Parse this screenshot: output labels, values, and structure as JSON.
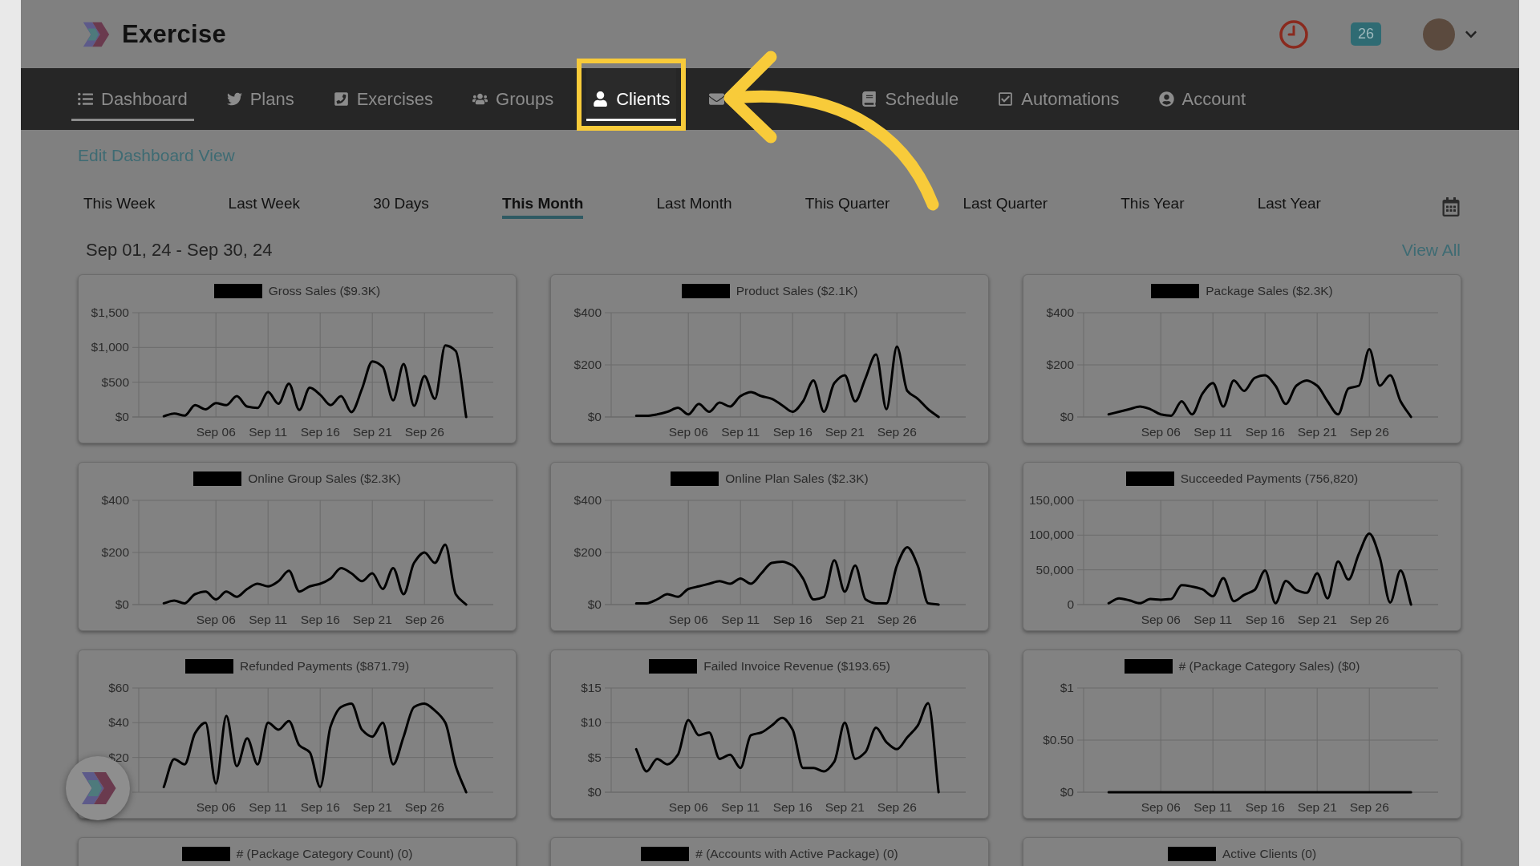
{
  "header": {
    "brand": "Exercise",
    "notification_count": "26"
  },
  "nav": {
    "items": [
      {
        "label": "Dashboard",
        "selected": true,
        "highlighted": false
      },
      {
        "label": "Plans",
        "selected": false,
        "highlighted": false
      },
      {
        "label": "Exercises",
        "selected": false,
        "highlighted": false
      },
      {
        "label": "Groups",
        "selected": false,
        "highlighted": false
      },
      {
        "label": "Clients",
        "selected": false,
        "highlighted": true
      },
      {
        "selected": false,
        "highlighted": false
      },
      {
        "label": "Schedule",
        "selected": false,
        "highlighted": false
      },
      {
        "label": "Automations",
        "selected": false,
        "highlighted": false
      },
      {
        "label": "Account",
        "selected": false,
        "highlighted": false
      }
    ]
  },
  "edit_link": "Edit Dashboard View",
  "ranges": [
    {
      "label": "This Week",
      "selected": false
    },
    {
      "label": "Last Week",
      "selected": false
    },
    {
      "label": "30 Days",
      "selected": false
    },
    {
      "label": "This Month",
      "selected": true
    },
    {
      "label": "Last Month",
      "selected": false
    },
    {
      "label": "This Quarter",
      "selected": false
    },
    {
      "label": "Last Quarter",
      "selected": false
    },
    {
      "label": "This Year",
      "selected": false
    },
    {
      "label": "Last Year",
      "selected": false
    }
  ],
  "date_range": "Sep 01, 24 - Sep 30, 24",
  "view_all": "View All",
  "cards": [
    {
      "chart_data": {
        "type": "line",
        "grid": true,
        "series": [
          {
            "name": "Gross Sales ($9.3K)",
            "color": "#000000",
            "values": [
              10,
              50,
              20,
              170,
              110,
              200,
              170,
              300,
              150,
              130,
              360,
              190,
              480,
              100,
              420,
              320,
              170,
              300,
              70,
              400,
              800,
              720,
              240,
              760,
              160,
              590,
              260,
              1030,
              950,
              0
            ]
          }
        ],
        "categories": [
          null,
          null,
          null,
          null,
          null,
          "Sep 06",
          null,
          null,
          null,
          null,
          "Sep 11",
          null,
          null,
          null,
          null,
          "Sep 16",
          null,
          null,
          null,
          null,
          "Sep 21",
          null,
          null,
          null,
          null,
          "Sep 26",
          null,
          null,
          null,
          null
        ],
        "ylim": [
          0,
          1500
        ],
        "yticks": [
          {
            "value": 0,
            "label": "$0"
          },
          {
            "value": 500,
            "label": "$500"
          },
          {
            "value": 1000,
            "label": "$1,000"
          },
          {
            "value": 1500,
            "label": "$1,500"
          }
        ]
      }
    },
    {
      "chart_data": {
        "type": "line",
        "grid": true,
        "series": [
          {
            "name": "Product Sales ($2.1K)",
            "color": "#000000",
            "values": [
              5,
              5,
              10,
              20,
              35,
              10,
              50,
              20,
              55,
              40,
              80,
              95,
              80,
              70,
              45,
              20,
              60,
              140,
              20,
              130,
              160,
              60,
              150,
              240,
              30,
              270,
              100,
              70,
              30,
              0
            ]
          }
        ],
        "categories": [
          null,
          null,
          null,
          null,
          null,
          "Sep 06",
          null,
          null,
          null,
          null,
          "Sep 11",
          null,
          null,
          null,
          null,
          "Sep 16",
          null,
          null,
          null,
          null,
          "Sep 21",
          null,
          null,
          null,
          null,
          "Sep 26",
          null,
          null,
          null,
          null
        ],
        "ylim": [
          0,
          400
        ],
        "yticks": [
          {
            "value": 0,
            "label": "$0"
          },
          {
            "value": 200,
            "label": "$200"
          },
          {
            "value": 400,
            "label": "$400"
          }
        ]
      }
    },
    {
      "chart_data": {
        "type": "line",
        "grid": true,
        "series": [
          {
            "name": "Package Sales ($2.3K)",
            "color": "#000000",
            "values": [
              10,
              20,
              30,
              40,
              30,
              10,
              5,
              60,
              10,
              90,
              130,
              40,
              140,
              100,
              150,
              160,
              120,
              50,
              120,
              140,
              120,
              60,
              10,
              110,
              120,
              260,
              120,
              160,
              60,
              0
            ]
          }
        ],
        "categories": [
          null,
          null,
          null,
          null,
          null,
          "Sep 06",
          null,
          null,
          null,
          null,
          "Sep 11",
          null,
          null,
          null,
          null,
          "Sep 16",
          null,
          null,
          null,
          null,
          "Sep 21",
          null,
          null,
          null,
          null,
          "Sep 26",
          null,
          null,
          null,
          null
        ],
        "ylim": [
          0,
          400
        ],
        "yticks": [
          {
            "value": 0,
            "label": "$0"
          },
          {
            "value": 200,
            "label": "$200"
          },
          {
            "value": 400,
            "label": "$400"
          }
        ]
      }
    },
    {
      "chart_data": {
        "type": "line",
        "grid": true,
        "series": [
          {
            "name": "Online Group Sales ($2.3K)",
            "color": "#000000",
            "values": [
              5,
              15,
              5,
              40,
              50,
              20,
              50,
              30,
              60,
              80,
              70,
              90,
              130,
              50,
              70,
              80,
              100,
              140,
              120,
              90,
              120,
              60,
              140,
              40,
              160,
              200,
              160,
              230,
              40,
              0
            ]
          }
        ],
        "categories": [
          null,
          null,
          null,
          null,
          null,
          "Sep 06",
          null,
          null,
          null,
          null,
          "Sep 11",
          null,
          null,
          null,
          null,
          "Sep 16",
          null,
          null,
          null,
          null,
          "Sep 21",
          null,
          null,
          null,
          null,
          "Sep 26",
          null,
          null,
          null,
          null
        ],
        "ylim": [
          0,
          400
        ],
        "yticks": [
          {
            "value": 0,
            "label": "$0"
          },
          {
            "value": 200,
            "label": "$200"
          },
          {
            "value": 400,
            "label": "$400"
          }
        ]
      }
    },
    {
      "chart_data": {
        "type": "line",
        "grid": true,
        "series": [
          {
            "name": "Online Plan Sales ($2.3K)",
            "color": "#000000",
            "values": [
              5,
              5,
              20,
              40,
              30,
              60,
              70,
              80,
              90,
              80,
              100,
              80,
              120,
              160,
              165,
              150,
              100,
              20,
              30,
              170,
              50,
              150,
              20,
              5,
              5,
              150,
              220,
              150,
              5,
              0
            ]
          }
        ],
        "categories": [
          null,
          null,
          null,
          null,
          null,
          "Sep 06",
          null,
          null,
          null,
          null,
          "Sep 11",
          null,
          null,
          null,
          null,
          "Sep 16",
          null,
          null,
          null,
          null,
          "Sep 21",
          null,
          null,
          null,
          null,
          "Sep 26",
          null,
          null,
          null,
          null
        ],
        "ylim": [
          0,
          400
        ],
        "yticks": [
          {
            "value": 0,
            "label": "$0"
          },
          {
            "value": 200,
            "label": "$200"
          },
          {
            "value": 400,
            "label": "$400"
          }
        ]
      }
    },
    {
      "chart_data": {
        "type": "line",
        "grid": true,
        "series": [
          {
            "name": "Succeeded Payments (756,820)",
            "color": "#000000",
            "values": [
              2000,
              9000,
              6000,
              2000,
              8000,
              7000,
              8000,
              28000,
              26000,
              22000,
              12000,
              38000,
              5000,
              14000,
              21000,
              49000,
              2000,
              34000,
              21000,
              17000,
              45000,
              9000,
              62000,
              36000,
              73000,
              102000,
              68000,
              3000,
              49000,
              0
            ]
          }
        ],
        "categories": [
          null,
          null,
          null,
          null,
          null,
          "Sep 06",
          null,
          null,
          null,
          null,
          "Sep 11",
          null,
          null,
          null,
          null,
          "Sep 16",
          null,
          null,
          null,
          null,
          "Sep 21",
          null,
          null,
          null,
          null,
          "Sep 26",
          null,
          null,
          null,
          null
        ],
        "ylim": [
          0,
          150000
        ],
        "yticks": [
          {
            "value": 0,
            "label": "0"
          },
          {
            "value": 50000,
            "label": "50,000"
          },
          {
            "value": 100000,
            "label": "100,000"
          },
          {
            "value": 150000,
            "label": "150,000"
          }
        ]
      }
    },
    {
      "chart_data": {
        "type": "line",
        "grid": true,
        "series": [
          {
            "name": "Refunded Payments ($871.79)",
            "color": "#000000",
            "values": [
              3,
              19,
              16,
              34,
              40,
              5,
              44,
              15,
              31,
              16,
              40,
              36,
              41,
              27,
              23,
              3,
              38,
              49,
              51,
              36,
              32,
              40,
              16,
              32,
              49,
              51,
              47,
              40,
              15,
              0
            ]
          }
        ],
        "categories": [
          null,
          null,
          null,
          null,
          null,
          "Sep 06",
          null,
          null,
          null,
          null,
          "Sep 11",
          null,
          null,
          null,
          null,
          "Sep 16",
          null,
          null,
          null,
          null,
          "Sep 21",
          null,
          null,
          null,
          null,
          "Sep 26",
          null,
          null,
          null,
          null
        ],
        "ylim": [
          0,
          60
        ],
        "yticks": [
          {
            "value": 20,
            "label": "$20"
          },
          {
            "value": 40,
            "label": "$40"
          },
          {
            "value": 60,
            "label": "$60"
          }
        ]
      }
    },
    {
      "chart_data": {
        "type": "line",
        "grid": true,
        "series": [
          {
            "name": "Failed Invoice Revenue ($193.65)",
            "color": "#000000",
            "values": [
              6.2,
              3,
              4.8,
              4,
              5.4,
              10.4,
              8.2,
              8.6,
              4.8,
              5.4,
              3.5,
              8.2,
              8.6,
              9.6,
              10.7,
              9,
              3.5,
              3.5,
              3,
              4.4,
              10,
              4.8,
              5.8,
              9.3,
              7.2,
              6.2,
              7.9,
              9.6,
              12.8,
              0
            ]
          }
        ],
        "categories": [
          null,
          null,
          null,
          null,
          null,
          "Sep 06",
          null,
          null,
          null,
          null,
          "Sep 11",
          null,
          null,
          null,
          null,
          "Sep 16",
          null,
          null,
          null,
          null,
          "Sep 21",
          null,
          null,
          null,
          null,
          "Sep 26",
          null,
          null,
          null,
          null
        ],
        "ylim": [
          0,
          15
        ],
        "yticks": [
          {
            "value": 0,
            "label": "$0"
          },
          {
            "value": 5,
            "label": "$5"
          },
          {
            "value": 10,
            "label": "$10"
          },
          {
            "value": 15,
            "label": "$15"
          }
        ]
      }
    },
    {
      "chart_data": {
        "type": "line",
        "grid": true,
        "series": [
          {
            "name": "# (Package Category Sales) ($0)",
            "color": "#000000",
            "values": [
              0,
              0,
              0,
              0,
              0,
              0,
              0,
              0,
              0,
              0,
              0,
              0,
              0,
              0,
              0,
              0,
              0,
              0,
              0,
              0,
              0,
              0,
              0,
              0,
              0,
              0,
              0,
              0,
              0,
              0
            ]
          }
        ],
        "categories": [
          null,
          null,
          null,
          null,
          null,
          "Sep 06",
          null,
          null,
          null,
          null,
          "Sep 11",
          null,
          null,
          null,
          null,
          "Sep 16",
          null,
          null,
          null,
          null,
          "Sep 21",
          null,
          null,
          null,
          null,
          "Sep 26",
          null,
          null,
          null,
          null
        ],
        "ylim": [
          0,
          1
        ],
        "yticks": [
          {
            "value": 0,
            "label": "$0"
          },
          {
            "value": 0.5,
            "label": "$0.50"
          },
          {
            "value": 1,
            "label": "$1"
          }
        ]
      }
    }
  ],
  "more_cards": [
    {
      "title": "# (Package Category Count) (0)"
    },
    {
      "title": "# (Accounts with Active Package) (0)"
    },
    {
      "title": "Active Clients (0)"
    }
  ]
}
